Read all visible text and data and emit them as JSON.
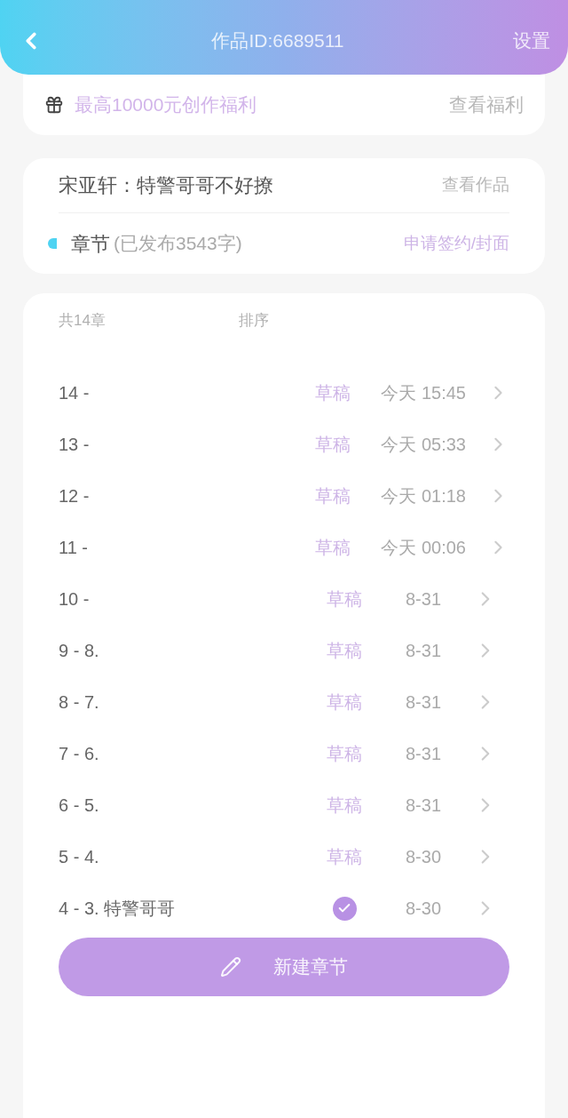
{
  "header": {
    "title": "作品ID:6689511",
    "settings": "设置"
  },
  "benefit": {
    "text": "最高10000元创作福利",
    "link": "查看福利"
  },
  "work": {
    "title": "宋亚轩：特警哥哥不好撩",
    "link": "查看作品",
    "section": "章节",
    "count": "(已发布3543字)",
    "apply": "申请签约/封面"
  },
  "list": {
    "total": "共14章",
    "sort": "排序",
    "rows": [
      {
        "title": "14 -",
        "kind": "draft",
        "status_text": "草稿",
        "date": "今天 15:45"
      },
      {
        "title": "13 -",
        "kind": "draft",
        "status_text": "草稿",
        "date": "今天 05:33"
      },
      {
        "title": "12 -",
        "kind": "draft",
        "status_text": "草稿",
        "date": "今天 01:18"
      },
      {
        "title": "11 -",
        "kind": "draft",
        "status_text": "草稿",
        "date": "今天 00:06"
      },
      {
        "title": "10 -",
        "kind": "draft",
        "status_text": "草稿",
        "date": "8-31"
      },
      {
        "title": "9 - 8.",
        "kind": "draft",
        "status_text": "草稿",
        "date": "8-31"
      },
      {
        "title": "8 - 7.",
        "kind": "draft",
        "status_text": "草稿",
        "date": "8-31"
      },
      {
        "title": "7 - 6.",
        "kind": "draft",
        "status_text": "草稿",
        "date": "8-31"
      },
      {
        "title": "6 - 5.",
        "kind": "draft",
        "status_text": "草稿",
        "date": "8-31"
      },
      {
        "title": "5 - 4.",
        "kind": "draft",
        "status_text": "草稿",
        "date": "8-30"
      },
      {
        "title": "4 - 3. 特警哥哥",
        "kind": "published",
        "date": "8-30"
      }
    ]
  },
  "new_button": "新建章节"
}
